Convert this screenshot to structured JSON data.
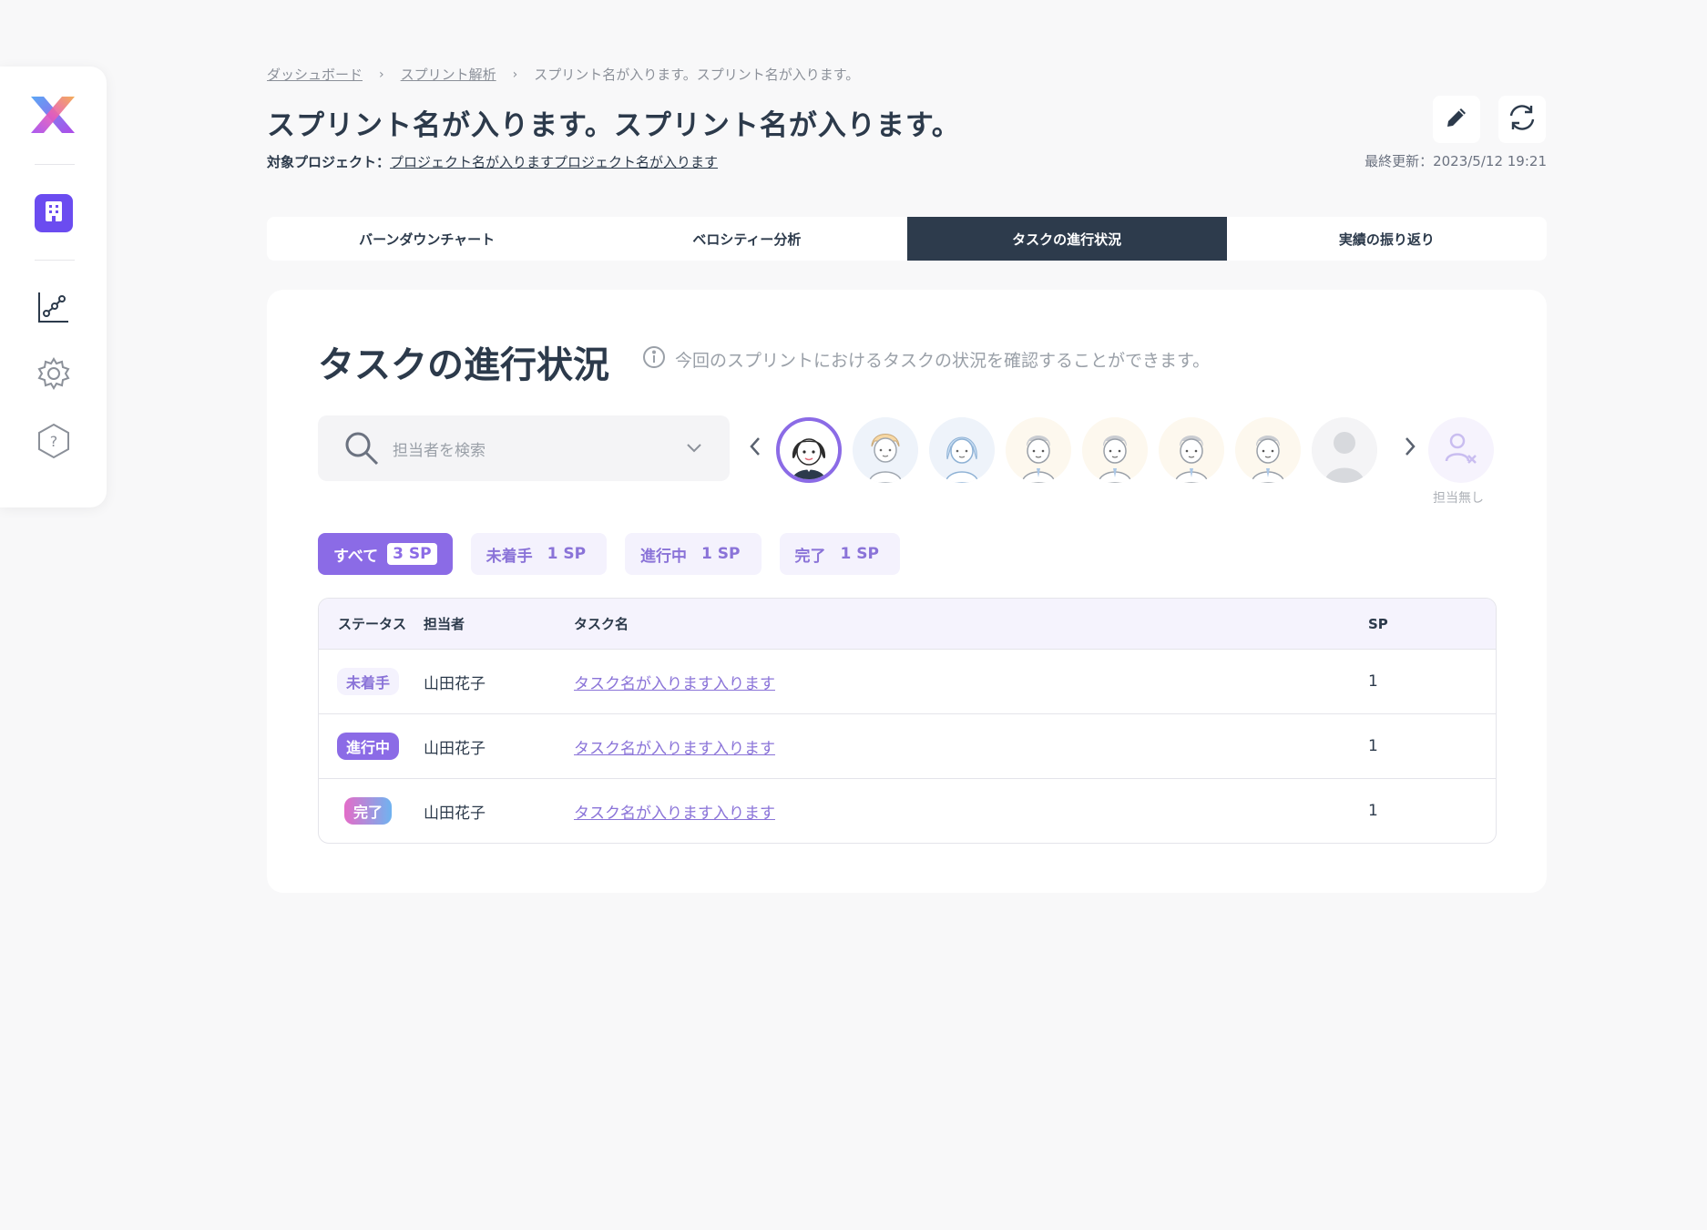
{
  "breadcrumb": {
    "items": [
      "ダッシュボード",
      "スプリント解析",
      "スプリント名が入ります。スプリント名が入ります。"
    ],
    "separator": "›"
  },
  "page": {
    "title": "スプリント名が入ります。スプリント名が入ります。",
    "project_label": "対象プロジェクト：",
    "project_name": "プロジェクト名が入りますプロジェクト名が入ります",
    "last_updated": "最終更新：2023/5/12 19:21"
  },
  "toolbar": {
    "edit_icon": "pencil-icon",
    "refresh_icon": "refresh-icon"
  },
  "sidebar": {
    "logo_icon": "x-logo-icon",
    "items": [
      {
        "icon": "building-icon",
        "active": true
      },
      {
        "icon": "chart-icon",
        "active": false
      },
      {
        "icon": "gear-icon",
        "active": false
      },
      {
        "icon": "help-icon",
        "active": false
      }
    ]
  },
  "tabs": [
    {
      "label": "バーンダウンチャート",
      "active": false
    },
    {
      "label": "ベロシティー分析",
      "active": false
    },
    {
      "label": "タスクの進行状況",
      "active": true
    },
    {
      "label": "実績の振り返り",
      "active": false
    }
  ],
  "section": {
    "title": "タスクの進行状況",
    "description": "今回のスプリントにおけるタスクの状況を確認することができます。"
  },
  "search": {
    "placeholder": "担当者を検索"
  },
  "assignees": {
    "no_assignee_label": "担当無し"
  },
  "filters": [
    {
      "label": "すべて",
      "sp": "3 SP",
      "active": true
    },
    {
      "label": "未着手",
      "sp": "1 SP",
      "active": false
    },
    {
      "label": "進行中",
      "sp": "1 SP",
      "active": false
    },
    {
      "label": "完了",
      "sp": "1 SP",
      "active": false
    }
  ],
  "table": {
    "headers": {
      "status": "ステータス",
      "assignee": "担当者",
      "task": "タスク名",
      "sp": "SP"
    },
    "rows": [
      {
        "status": "未着手",
        "assignee": "山田花子",
        "task": "タスク名が入ります入ります",
        "sp": "1"
      },
      {
        "status": "進行中",
        "assignee": "山田花子",
        "task": "タスク名が入ります入ります",
        "sp": "1"
      },
      {
        "status": "完了",
        "assignee": "山田花子",
        "task": "タスク名が入ります入ります",
        "sp": "1"
      }
    ]
  },
  "colors": {
    "accent": "#8b6be6",
    "dark_tab": "#2d3b4c",
    "sidebar_active": "#6b4cf0"
  }
}
